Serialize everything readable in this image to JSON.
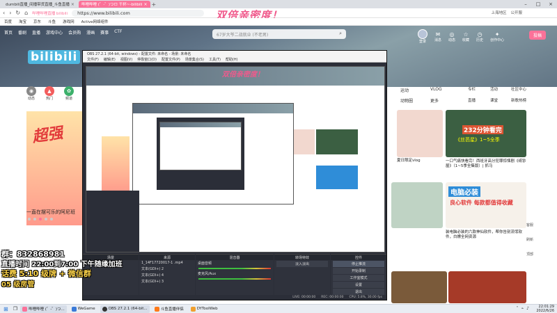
{
  "tabs": [
    {
      "label": "dumbili直播_间播带货直播_斗鱼直播",
      "active": false
    },
    {
      "label": "哔哩哔哩 (゜-゜)つロ 干杯~-bilibili",
      "active": true
    }
  ],
  "address": {
    "url": "https://www.bilibili.com",
    "prefix": "哔哩哔哩直播 bilibili"
  },
  "bookmarks": [
    "百度",
    "淘宝",
    "京东",
    "斗鱼",
    "游戏网",
    "Active网络组件"
  ],
  "ad_title": "双倍亲密度！",
  "system_info": [
    "上海地区",
    "公开服"
  ],
  "bili_nav": [
    "首页",
    "番剧",
    "直播",
    "游戏中心",
    "会员购",
    "漫画",
    "赛事",
    "CTF"
  ],
  "search": {
    "placeholder": "67岁大爷二战就业 (不老男)"
  },
  "header_right": [
    {
      "label": "登录",
      "icon": "avatar"
    },
    {
      "label": "消息",
      "icon": "message-icon"
    },
    {
      "label": "动态",
      "icon": "dynamic-icon"
    },
    {
      "label": "收藏",
      "icon": "star-icon"
    },
    {
      "label": "历史",
      "icon": "history-icon"
    },
    {
      "label": "创作中心",
      "icon": "bulb-icon"
    }
  ],
  "upload_label": "投稿",
  "logo_text": "bilibili",
  "channels": [
    {
      "label": "动态",
      "color": "#888888"
    },
    {
      "label": "热门",
      "color": "#f25d5d"
    },
    {
      "label": "频道",
      "color": "#3db06b"
    }
  ],
  "promo_big": "超强",
  "promo_caption": "一直在摆可乐的阿尼班",
  "vtabs": [
    "运动",
    "VLOG",
    "动物圈",
    "更多"
  ],
  "side_nav": [
    "专栏",
    "活动",
    "社区中心",
    "直播",
    "课堂",
    "新歌热榜"
  ],
  "cards": [
    {
      "title": "夏日限定vlog",
      "sub": "",
      "color": "#f2d8cf"
    },
    {
      "title": "232分钟看完",
      "sub": "《丝芭星》1~5全季",
      "color": "#3b5f42"
    },
    {
      "title": "一口气痛快看完！西班牙高分犯罪惊悚剧《纸钞屋》（1~5季全集版）| 抓马",
      "sub": "",
      "color": ""
    },
    {
      "title": "电脑必装",
      "sub": "良心软件 每款都值得收藏",
      "color": "#2f8dd8"
    },
    {
      "title": "装电脑必装的六款神仙软件，帮你告别流氓软件，白嫖全网资源",
      "sub": "",
      "color": ""
    }
  ],
  "right_rail": [
    "客服",
    "刷新",
    "顶部"
  ],
  "overlay": {
    "qq": "群：832868981",
    "time": "直播时间 22:00到7:00 下午随缘加班",
    "promo": "话费 5:10 级牌 + 微信群",
    "level": "05 级",
    "rank": "房管"
  },
  "obs": {
    "title": "OBS 27.2.1 (64-bit, windows) - 配置文件: 未命名 - 场景: 未命名",
    "menu": [
      "文件(F)",
      "编辑(E)",
      "视图(V)",
      "停靠窗口(D)",
      "配置文件(P)",
      "场景集合(S)",
      "工具(T)",
      "帮助(H)"
    ],
    "docks": [
      {
        "title": "场景",
        "items": [
          "场景"
        ]
      },
      {
        "title": "来源",
        "items": [
          "1_14F17720017-1 .mp4",
          "文本(GDI+) 2",
          "文本(GDI+) 4",
          "文本(GDI+) 3"
        ]
      },
      {
        "title": "混音器",
        "items": [
          "桌面音频",
          "麦克风/Aux"
        ]
      },
      {
        "title": "转场特效",
        "items": [
          "淡入淡出"
        ]
      },
      {
        "title": "控件",
        "items": [
          "停止推流",
          "开始录制",
          "工作室模式",
          "设置",
          "退出"
        ]
      }
    ],
    "status": [
      "LIVE: 00:00:00",
      "REC: 00:00:00",
      "CPU: 5.8%, 30.00 fps"
    ]
  },
  "taskbar": [
    {
      "label": "哔哩哔哩 (゜-゜)つ...",
      "color": "#fb7299",
      "active": true
    },
    {
      "label": "WeGame",
      "color": "#3a7ad8",
      "active": false
    },
    {
      "label": "OBS 27.2.1 (64-bit...",
      "color": "#333333",
      "active": true
    },
    {
      "label": "斗鱼直播伴侣",
      "color": "#ff7a1a",
      "active": false
    },
    {
      "label": "DYToolWeb",
      "color": "#f0a030",
      "active": false
    }
  ],
  "clock": {
    "time": "22:01:29",
    "date": "2022/6/26"
  }
}
